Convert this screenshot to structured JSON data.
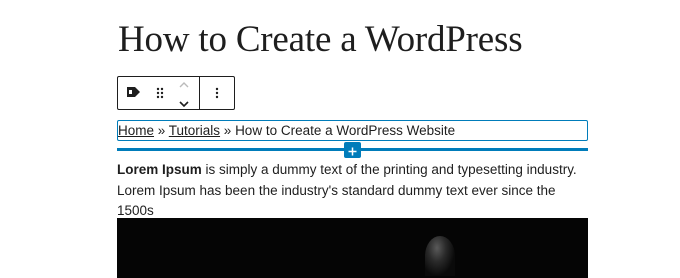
{
  "post": {
    "title": "How to Create a WordPress Website"
  },
  "toolbar": {
    "block_type_icon": "breadcrumbs-tag-icon",
    "drag_icon": "drag-handle-icon",
    "move_up_icon": "chevron-up-icon",
    "move_down_icon": "chevron-down-icon",
    "options_icon": "more-vertical-icon"
  },
  "breadcrumb": {
    "home": "Home",
    "sep1": " » ",
    "tutorials": "Tutorials",
    "sep2": " » ",
    "current": "How to Create a WordPress Website"
  },
  "inserter": {
    "icon": "plus-icon"
  },
  "paragraph": {
    "bold": "Lorem Ipsum",
    "text": " is simply a dummy text of the printing and typesetting industry. Lorem Ipsum has been the industry's standard dummy text ever since the 1500s"
  },
  "colors": {
    "accent": "#007cba",
    "text": "#1e1e1e",
    "image_bg": "#050505"
  }
}
